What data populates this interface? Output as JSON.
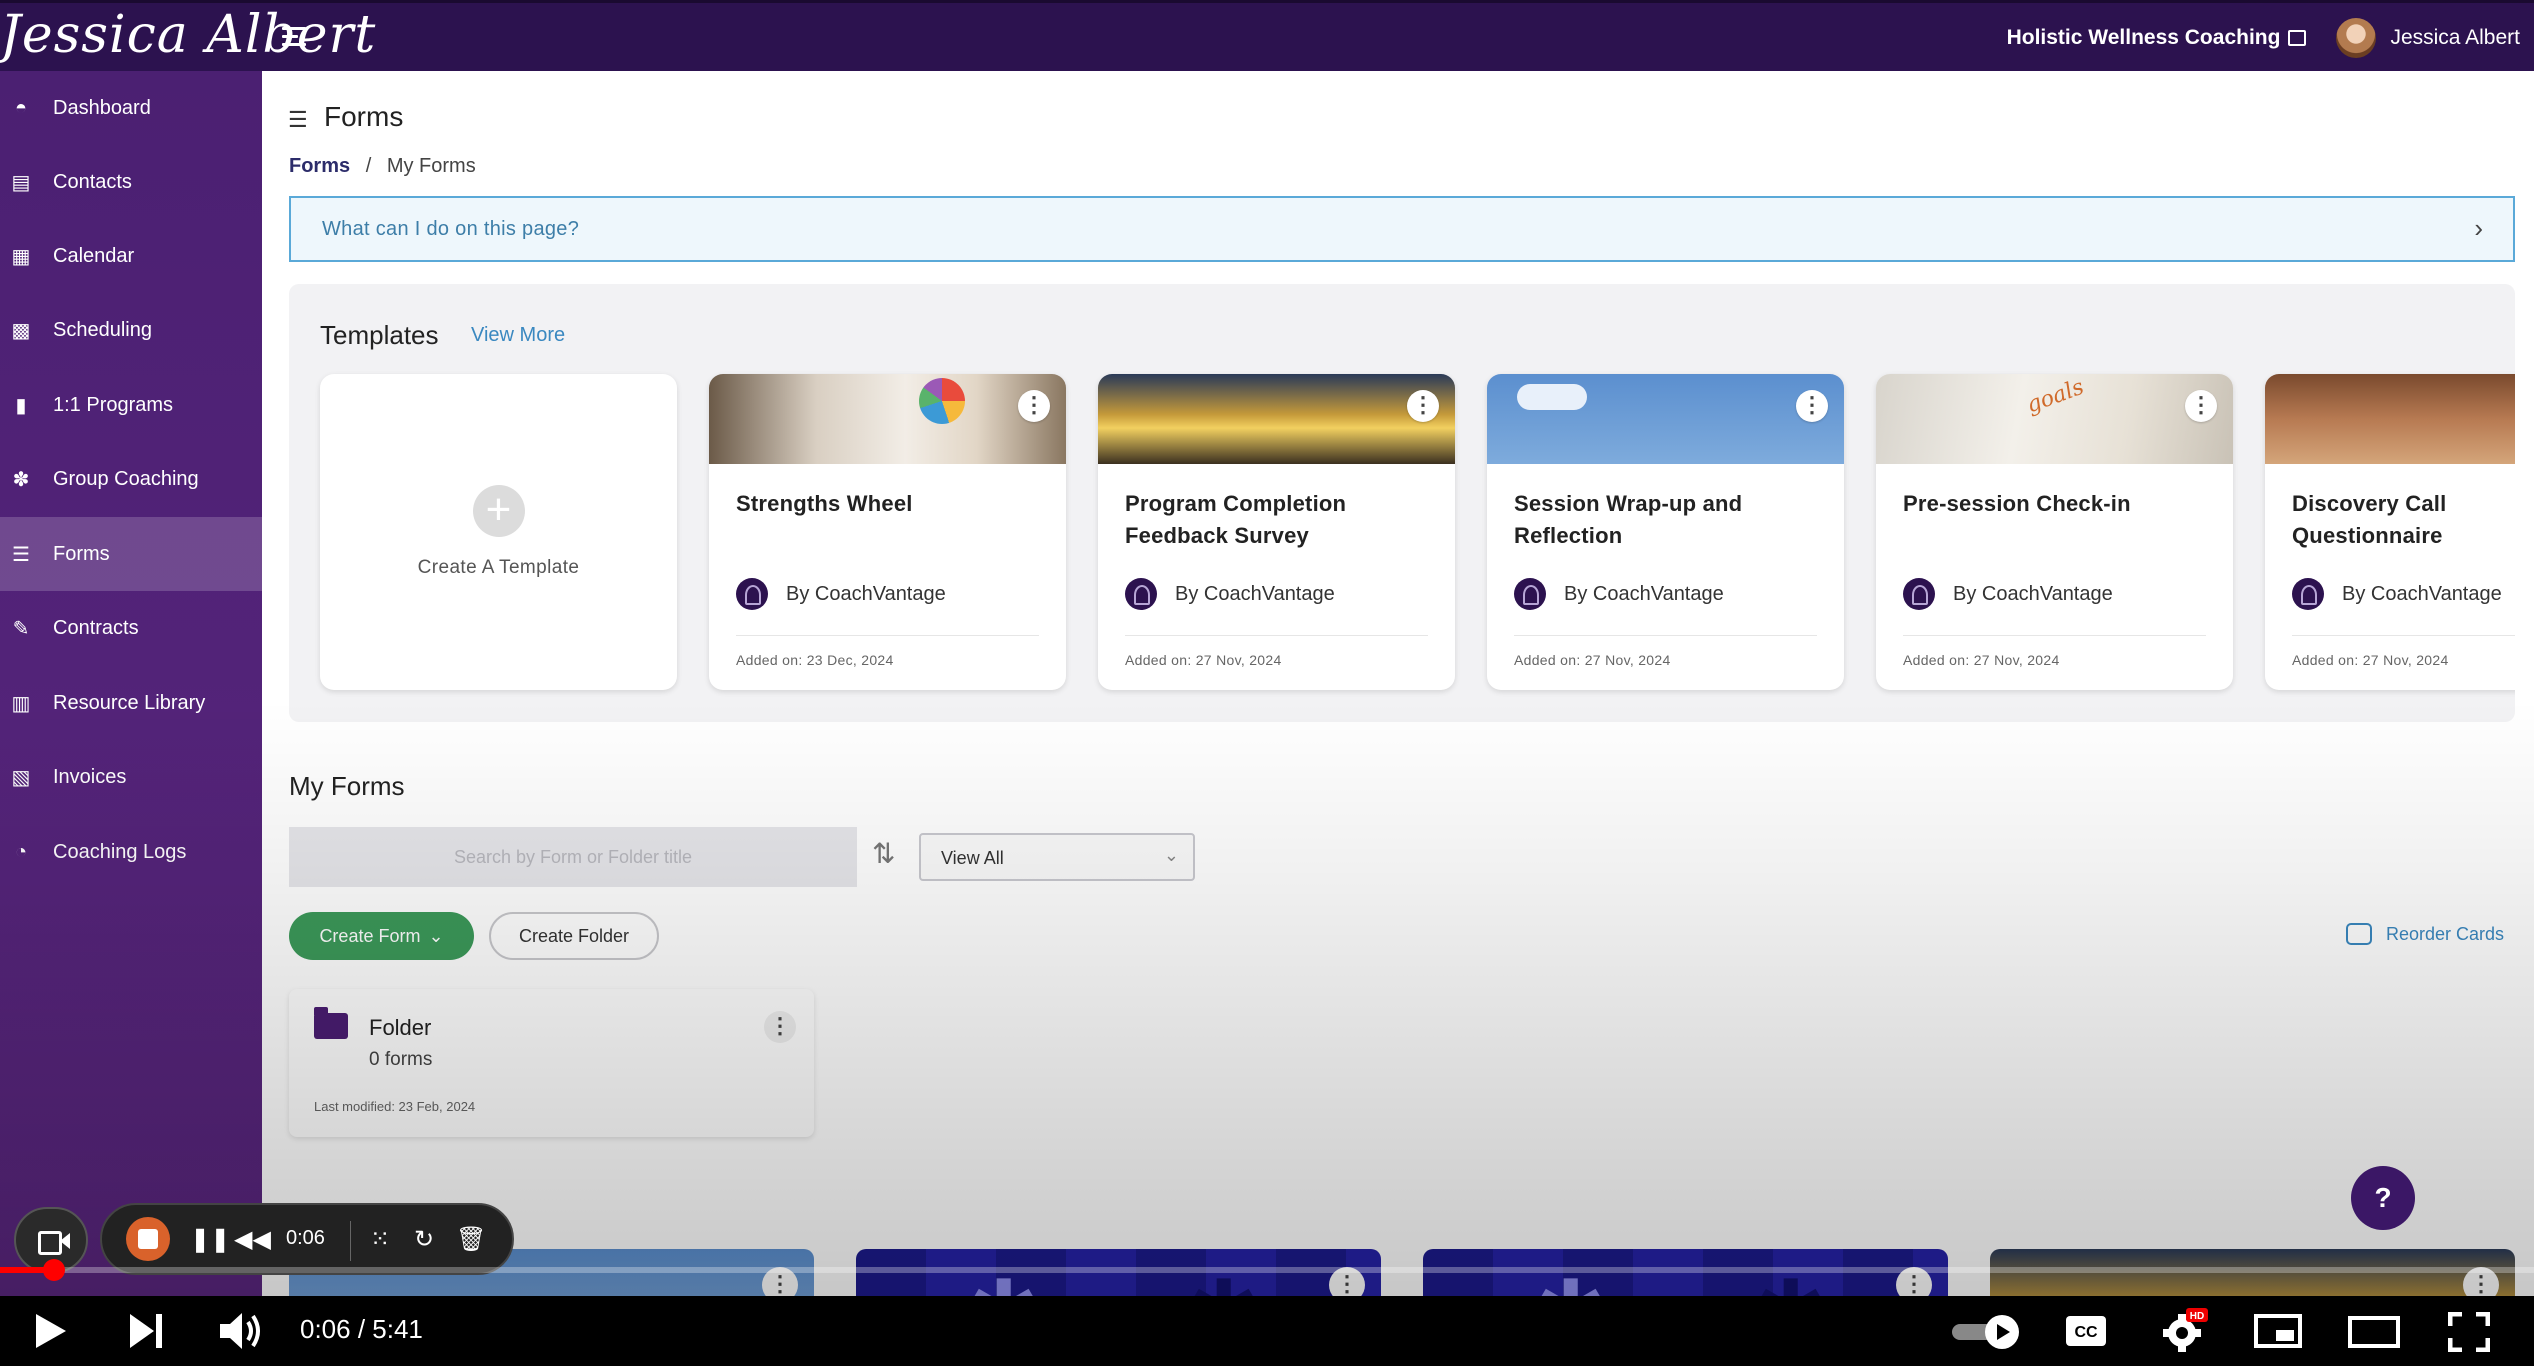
{
  "app": {
    "logo_text": "Jessica Albert",
    "org_name": "Holistic Wellness Coaching",
    "user_name": "Jessica Albert"
  },
  "sidebar": {
    "items": [
      {
        "label": "Dashboard",
        "icon": "dashboard-icon",
        "glyph": "◓"
      },
      {
        "label": "Contacts",
        "icon": "contacts-icon",
        "glyph": "▤"
      },
      {
        "label": "Calendar",
        "icon": "calendar-icon",
        "glyph": "▦"
      },
      {
        "label": "Scheduling",
        "icon": "scheduling-icon",
        "glyph": "▩"
      },
      {
        "label": "1:1 Programs",
        "icon": "book-icon",
        "glyph": "▮"
      },
      {
        "label": "Group Coaching",
        "icon": "group-icon",
        "glyph": "✽"
      },
      {
        "label": "Forms",
        "icon": "forms-icon",
        "glyph": "☰"
      },
      {
        "label": "Contracts",
        "icon": "contract-icon",
        "glyph": "✎"
      },
      {
        "label": "Resource Library",
        "icon": "library-icon",
        "glyph": "▥"
      },
      {
        "label": "Invoices",
        "icon": "invoice-icon",
        "glyph": "▧"
      },
      {
        "label": "Coaching Logs",
        "icon": "clock-icon",
        "glyph": "◔"
      }
    ],
    "active_label": "Forms"
  },
  "page": {
    "title": "Forms",
    "breadcrumb_root": "Forms",
    "breadcrumb_sep": "/",
    "breadcrumb_current": "My Forms",
    "help_prompt": "What can I do on this page?"
  },
  "templates": {
    "title": "Templates",
    "view_more": "View More",
    "create_label": "Create A Template",
    "cards": [
      {
        "title": "Strengths Wheel",
        "author": "By CoachVantage",
        "added": "Added on: 23 Dec, 2024"
      },
      {
        "title": "Program Completion Feedback Survey",
        "author": "By CoachVantage",
        "added": "Added on: 27 Nov, 2024"
      },
      {
        "title": "Session Wrap-up and Reflection",
        "author": "By CoachVantage",
        "added": "Added on: 27 Nov, 2024"
      },
      {
        "title": "Pre-session Check-in",
        "author": "By CoachVantage",
        "added": "Added on: 27 Nov, 2024"
      },
      {
        "title": "Discovery Call Questionnaire",
        "author": "By CoachVantage",
        "added": "Added on: 27 Nov, 2024"
      }
    ]
  },
  "my_forms": {
    "title": "My Forms",
    "search_placeholder": "Search by Form or Folder title",
    "filter_value": "View All",
    "create_form": "Create Form",
    "create_folder": "Create Folder",
    "reorder": "Reorder Cards",
    "folder": {
      "name": "Folder",
      "count": "0 forms",
      "modified": "Last modified: 23 Feb, 2024"
    }
  },
  "help_bubble": "?",
  "recorder": {
    "time": "0:06"
  },
  "video": {
    "time": "0:06 / 5:41",
    "progress_fraction": 0.0176,
    "hd_badge": "HD"
  },
  "colors": {
    "brand_dark": "#2c124f",
    "sidebar": "#4b2072",
    "accent_green": "#3c9a5a",
    "link_blue": "#3a88c0",
    "progress_red": "#ff0000"
  }
}
